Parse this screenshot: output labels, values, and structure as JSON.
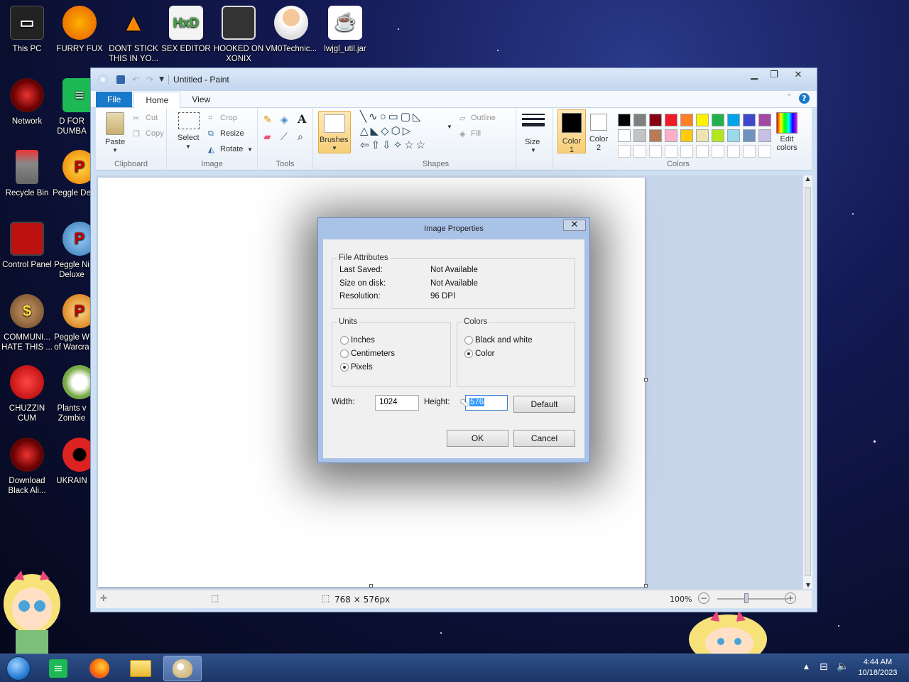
{
  "desktop_icons": [
    {
      "label": "This PC"
    },
    {
      "label": "FURRY FUX"
    },
    {
      "label": "DONT STICK THIS IN YO..."
    },
    {
      "label": "SEX EDITOR"
    },
    {
      "label": "HOOKED ON XONIX"
    },
    {
      "label": "VM0Technic..."
    },
    {
      "label": "lwjgl_util.jar"
    },
    {
      "label": "Network"
    },
    {
      "label": "D FOR DUMBA"
    },
    {
      "label": "Recycle Bin"
    },
    {
      "label": "Peggle De"
    },
    {
      "label": "Control Panel"
    },
    {
      "label": "Peggle Ni Deluxe"
    },
    {
      "label": "COMMUNI... HATE THIS ..."
    },
    {
      "label": "Peggle W of Warcra"
    },
    {
      "label": "CHUZZIN CUM"
    },
    {
      "label": "Plants v Zombie"
    },
    {
      "label": "Download Black Ali..."
    },
    {
      "label": "UKRAIN"
    }
  ],
  "paint": {
    "title": "Untitled - Paint",
    "tabs": {
      "file": "File",
      "home": "Home",
      "view": "View"
    },
    "ribbon": {
      "paste": "Paste",
      "cut": "Cut",
      "copy": "Copy",
      "clipboard": "Clipboard",
      "select": "Select",
      "crop": "Crop",
      "resize": "Resize",
      "rotate": "Rotate",
      "image": "Image",
      "tools": "Tools",
      "brushes": "Brushes",
      "outline": "Outline",
      "fill": "Fill",
      "shapes": "Shapes",
      "size": "Size",
      "color1": "Color 1",
      "color2": "Color 2",
      "edit_colors": "Edit colors",
      "colors": "Colors"
    },
    "palette_row1": [
      "#000000",
      "#7f7f7f",
      "#880015",
      "#ed1c24",
      "#ff7f27",
      "#fff200",
      "#22b14c",
      "#00a2e8",
      "#3f48cc",
      "#a349a4"
    ],
    "palette_row2": [
      "#ffffff",
      "#c3c3c3",
      "#b97a57",
      "#ffaec9",
      "#ffc90e",
      "#efe4b0",
      "#b5e61d",
      "#99d9ea",
      "#7092be",
      "#c8bfe7"
    ],
    "status": {
      "dimensions": "768 × 576px",
      "zoom": "100%"
    }
  },
  "dialog": {
    "title": "Image Properties",
    "file_attributes": "File Attributes",
    "last_saved_label": "Last Saved:",
    "last_saved_value": "Not Available",
    "size_label": "Size on disk:",
    "size_value": "Not Available",
    "resolution_label": "Resolution:",
    "resolution_value": "96 DPI",
    "units": "Units",
    "inches": "Inches",
    "centimeters": "Centimeters",
    "pixels": "Pixels",
    "colors": "Colors",
    "bw": "Black and white",
    "color": "Color",
    "width_label": "Width:",
    "width_value": "1024",
    "height_label": "Height:",
    "height_value": "576",
    "default": "Default",
    "ok": "OK",
    "cancel": "Cancel"
  },
  "clock": {
    "time": "4:44 AM",
    "date": "10/18/2023"
  }
}
